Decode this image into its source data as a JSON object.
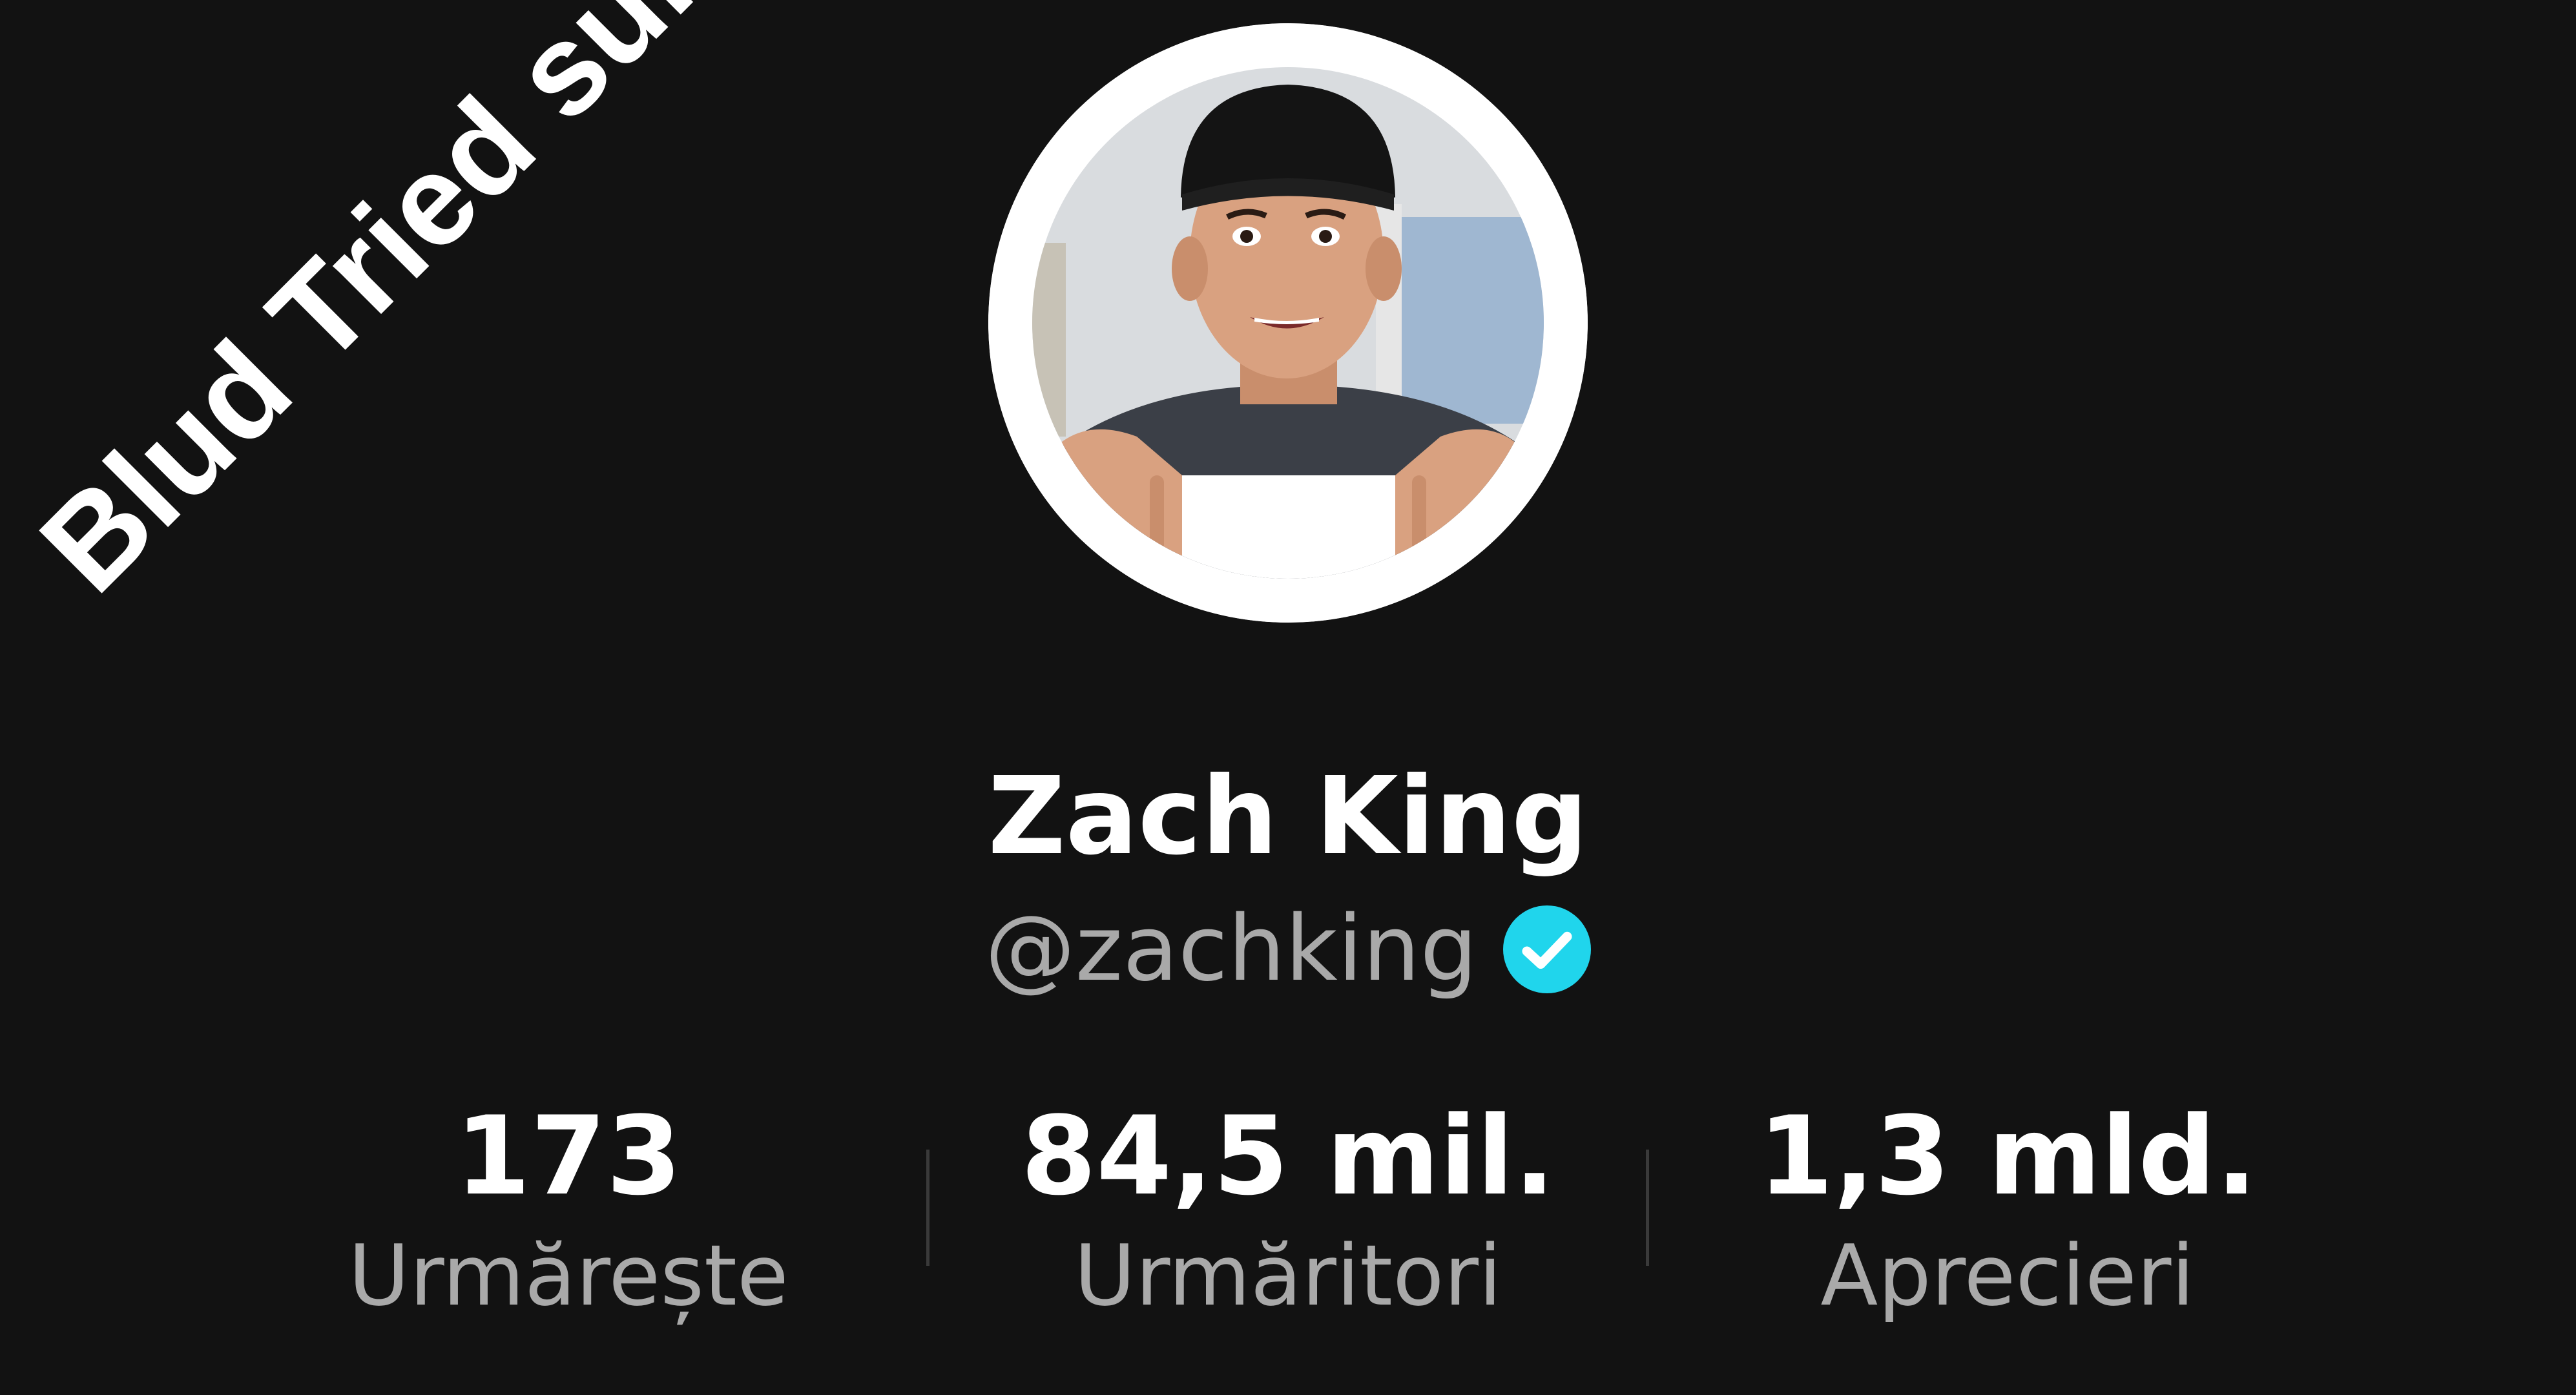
{
  "overlay": {
    "caption": "Blud Tried sum"
  },
  "profile": {
    "name": "Zach King",
    "handle": "@zachking",
    "verified": true,
    "verified_icon": "verified-check-icon"
  },
  "stats": [
    {
      "value": "173",
      "label": "Urmărește"
    },
    {
      "value": "84,5 mil.",
      "label": "Urmăritori"
    },
    {
      "value": "1,3 mld.",
      "label": "Aprecieri"
    }
  ],
  "colors": {
    "background": "#121212",
    "text_primary": "#ffffff",
    "text_secondary": "#a9a9a9",
    "verified_badge": "#20d5ec",
    "divider": "#3a3a3a"
  }
}
